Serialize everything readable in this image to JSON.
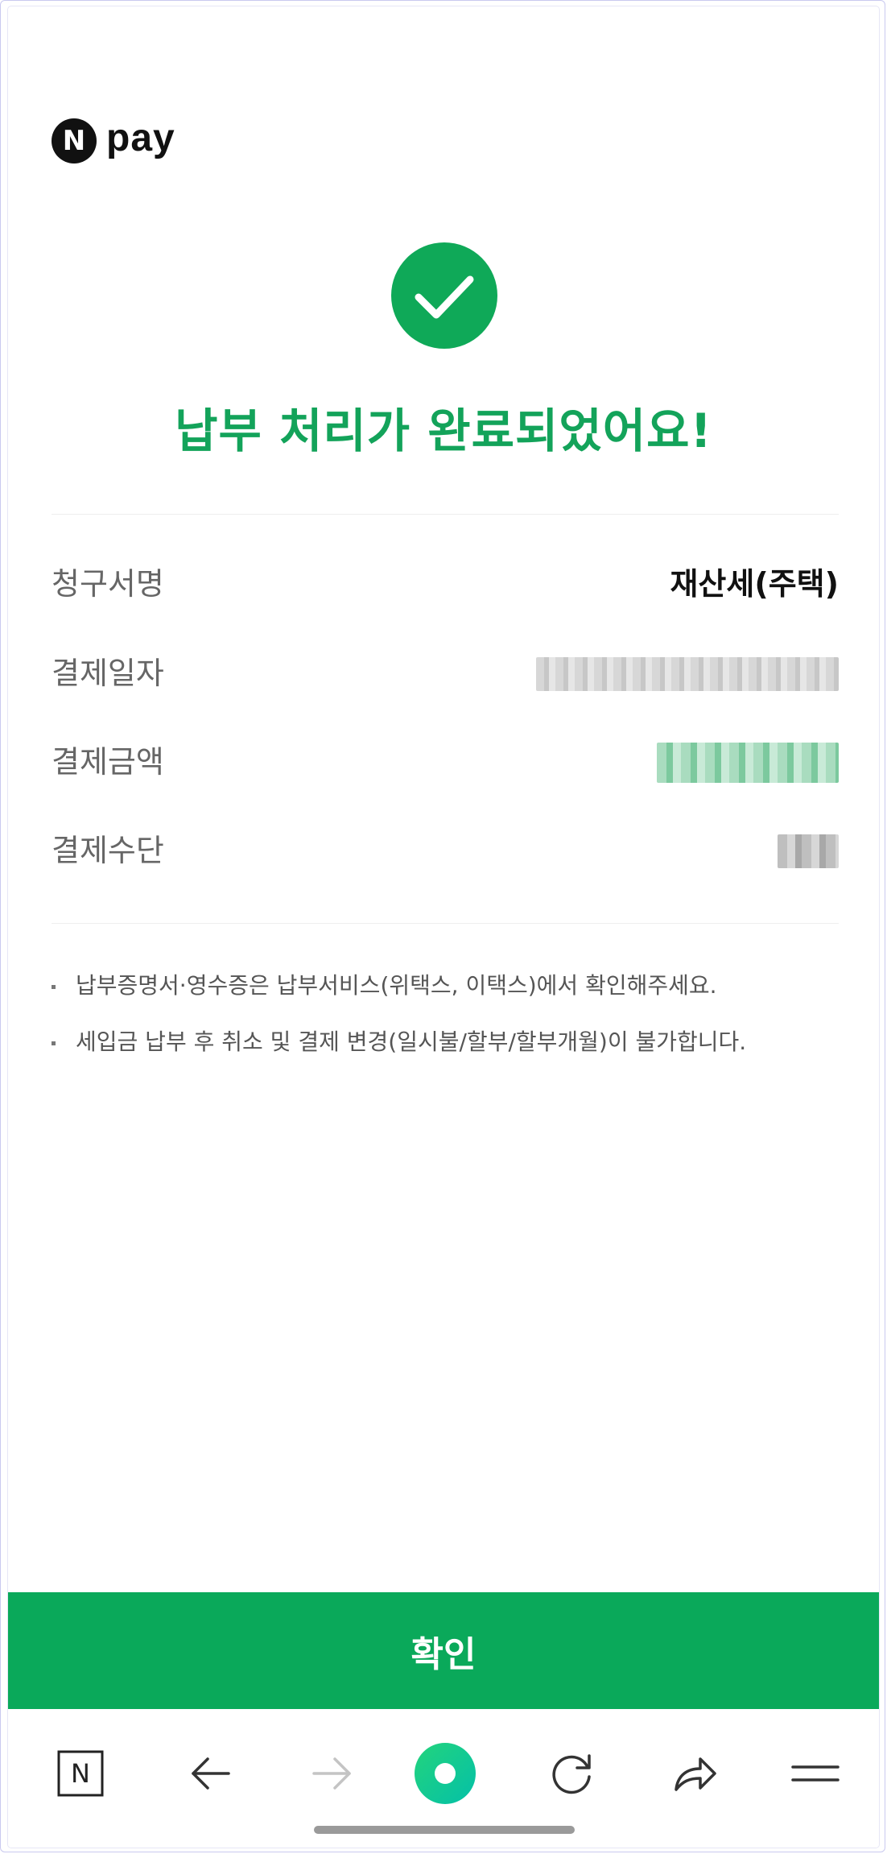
{
  "brand": {
    "logo_letter": "N",
    "logo_text": "pay"
  },
  "status": {
    "title": "납부 처리가 완료되었어요!"
  },
  "details": [
    {
      "label": "청구서명",
      "value": "재산세(주택)"
    },
    {
      "label": "결제일자",
      "value": ""
    },
    {
      "label": "결제금액",
      "value": ""
    },
    {
      "label": "결제수단",
      "value": ""
    }
  ],
  "notes": [
    "납부증명서·영수증은 납부서비스(위택스, 이택스)에서 확인해주세요.",
    "세입금 납부 후 취소 및 결제 변경(일시불/할부/할부개월)이 불가합니다."
  ],
  "confirm_button": {
    "label": "확인"
  },
  "nav": {
    "items": [
      {
        "icon": "naver-home-icon"
      },
      {
        "icon": "back-arrow-icon"
      },
      {
        "icon": "forward-arrow-icon"
      },
      {
        "icon": "green-dot-icon"
      },
      {
        "icon": "refresh-icon"
      },
      {
        "icon": "share-icon"
      },
      {
        "icon": "menu-icon"
      }
    ],
    "home_letter": "N"
  },
  "colors": {
    "accent": "#0aa95a",
    "title_green": "#13a35a"
  }
}
